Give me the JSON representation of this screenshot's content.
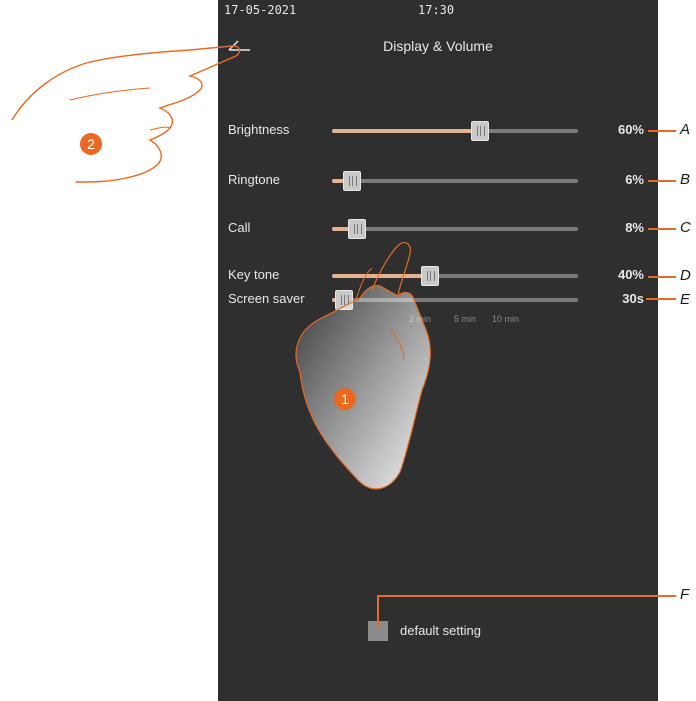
{
  "status_bar": {
    "date": "17-05-2021",
    "time": "17:30"
  },
  "header": {
    "title": "Display & Volume",
    "back_icon": "arrow-left-icon"
  },
  "settings": [
    {
      "label": "Brightness",
      "value": "60%",
      "level": 0.6,
      "callout": "A"
    },
    {
      "label": "Ringtone",
      "value": "6%",
      "level": 0.08,
      "callout": "B"
    },
    {
      "label": "Call",
      "value": "8%",
      "level": 0.1,
      "callout": "C"
    },
    {
      "label": "Key tone",
      "value": "40%",
      "level": 0.4,
      "callout": "D"
    },
    {
      "label": "Screen saver",
      "value": "30s",
      "level": 0.05,
      "callout": "E"
    }
  ],
  "screen_saver_ticks": [
    "2 min",
    "5 min",
    "10 min"
  ],
  "default_setting": {
    "label": "default setting",
    "callout": "F"
  },
  "step_badges": [
    "1",
    "2"
  ],
  "colors": {
    "screen_bg": "#2f2f2f",
    "accent": "#e6b18f",
    "callout": "#e86a24"
  }
}
